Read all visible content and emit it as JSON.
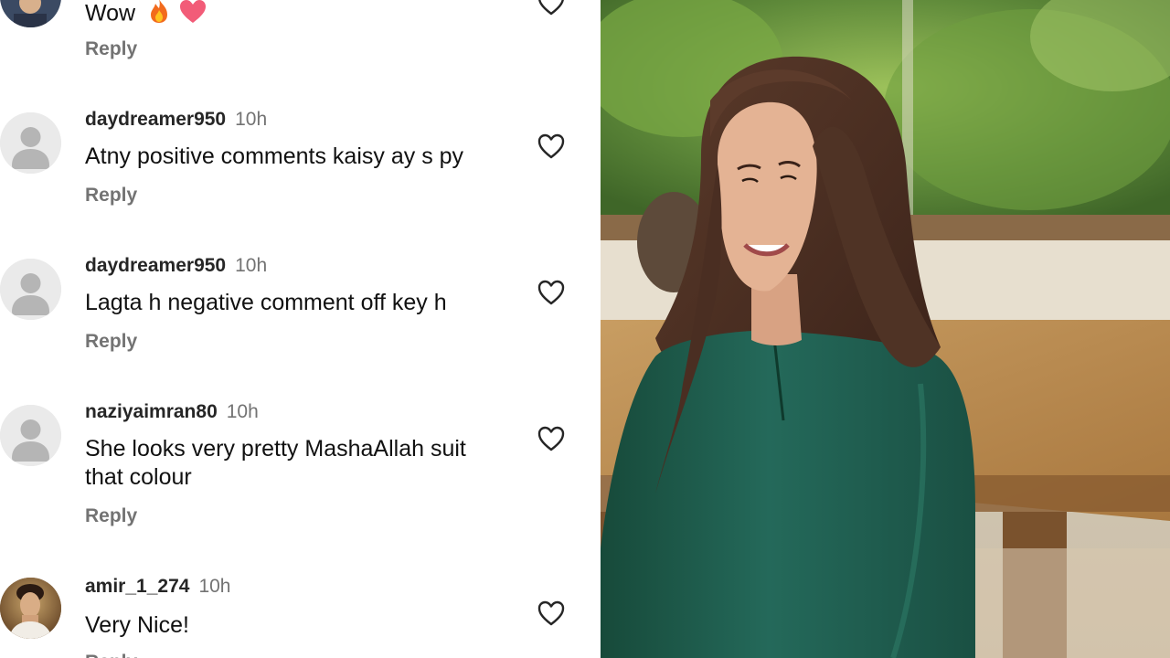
{
  "comments": [
    {
      "username": "",
      "time": "",
      "text": "Wow",
      "emojis": [
        "fire-emoji",
        "heart-emoji"
      ],
      "reply_label": "Reply",
      "avatar": "user-photo-avatar",
      "like_icon": "heart-outline-icon"
    },
    {
      "username": "daydreamer950",
      "time": "10h",
      "text": "Atny positive comments kaisy ay s py",
      "reply_label": "Reply",
      "avatar": "default-avatar",
      "like_icon": "heart-outline-icon"
    },
    {
      "username": "daydreamer950",
      "time": "10h",
      "text": "Lagta h negative comment off key h",
      "reply_label": "Reply",
      "avatar": "default-avatar",
      "like_icon": "heart-outline-icon"
    },
    {
      "username": "naziyaimran80",
      "time": "10h",
      "text": "She looks very pretty MashaAllah suit that colour",
      "reply_label": "Reply",
      "avatar": "default-avatar",
      "like_icon": "heart-outline-icon"
    },
    {
      "username": "amir_1_274",
      "time": "10h",
      "text": "Very Nice!",
      "reply_label": "Reply",
      "avatar": "user-photo-avatar",
      "like_icon": "heart-outline-icon"
    }
  ],
  "photo": {
    "description_icon": "woman-portrait-photo",
    "colors": {
      "dress": "#1f5b48",
      "hair": "#4a3024",
      "foliage": "#5f8a3a",
      "table": "#b8894e"
    }
  },
  "colors": {
    "username": "#262626",
    "secondary_text": "#737373",
    "body_text": "#111111",
    "default_avatar_bg": "#eaeaea",
    "default_avatar_fg": "#b5b5b5"
  }
}
